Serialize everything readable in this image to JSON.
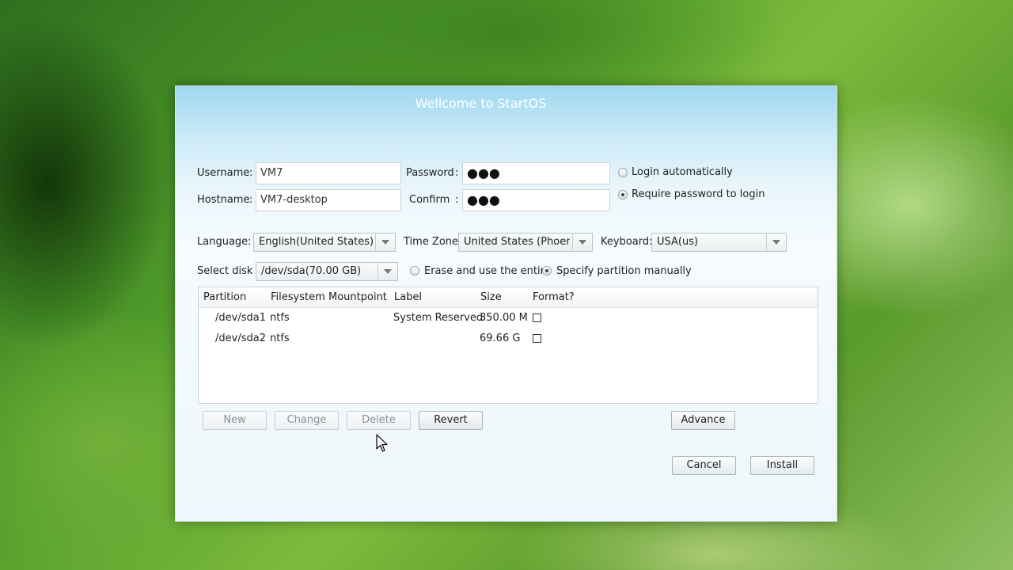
{
  "window": {
    "title": "Wellcome to StartOS"
  },
  "account": {
    "username_label": "Username",
    "username_value": "VM7",
    "hostname_label": "Hostname",
    "hostname_value": "VM7-desktop",
    "password_label": "Password",
    "password_value": "●●●",
    "confirm_label": "Confirm",
    "confirm_value": "●●●",
    "separator": ":",
    "login_auto_label": "Login automatically",
    "require_password_label": "Require password to login",
    "selected_login_option": "Require password to login"
  },
  "locale": {
    "language_label": "Language:",
    "language_value": "English(United States)",
    "timezone_label": "Time Zone:",
    "timezone_value": "United States (Phoenix)",
    "keyboard_label": "Keyboard:",
    "keyboard_value": "USA(us)"
  },
  "disk": {
    "select_label": "Select disk :",
    "select_value": "/dev/sda(70.00 GB)",
    "erase_label": "Erase and use the entire",
    "manual_label": "Specify partition manually",
    "selected_option": "Specify partition manually"
  },
  "partitions": {
    "columns": [
      "Partition",
      "Filesystem",
      "Mountpoint",
      "Label",
      "Size",
      "Format?"
    ],
    "rows": [
      {
        "partition": "/dev/sda1",
        "filesystem": "ntfs",
        "mountpoint": "",
        "label": "System Reserved",
        "size": "350.00 M",
        "format": false
      },
      {
        "partition": "/dev/sda2",
        "filesystem": "ntfs",
        "mountpoint": "",
        "label": "",
        "size": "69.66 G",
        "format": false
      }
    ]
  },
  "buttons": {
    "new": "New",
    "change": "Change",
    "delete": "Delete",
    "revert": "Revert",
    "advance": "Advance",
    "cancel": "Cancel",
    "install": "Install"
  },
  "icons": {
    "dropdown": "chevron-down-icon",
    "pointer": "mouse-pointer-icon"
  }
}
